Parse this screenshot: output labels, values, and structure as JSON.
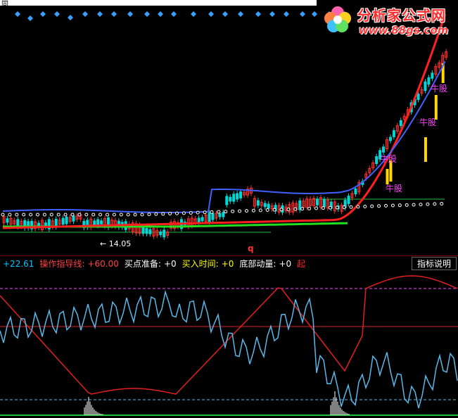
{
  "top_title": "同",
  "logo": {
    "title": "分析家公式网",
    "url": "www.88gs.com"
  },
  "chart": {
    "low_price_label": "14.05",
    "q_mark": "q",
    "signal_label": "牛股",
    "colors": {
      "up": "#ff3030",
      "down": "#00d8d8",
      "ma_red": "#ff2020",
      "ma_blue": "#4060ff",
      "ma_green": "#20e020",
      "signal_yellow": "#ffd800",
      "signal_magenta": "#ff40ff",
      "diamond": "#3aa0ff",
      "osc_blue": "#5ab8e8",
      "osc_red": "#e02020"
    }
  },
  "indicator": {
    "items": [
      {
        "label": "",
        "value": "+22.61",
        "label_color": "#00c8ff",
        "value_color": "#00c8ff"
      },
      {
        "label": "操作指导线:",
        "value": "+60.00",
        "label_color": "#ff4040",
        "value_color": "#ff4040"
      },
      {
        "label": "买点准备:",
        "value": "+0",
        "label_color": "#ffffff",
        "value_color": "#ffffff"
      },
      {
        "label": "买入时间:",
        "value": "+0",
        "label_color": "#ffff00",
        "value_color": "#ffff00"
      },
      {
        "label": "底部动量:",
        "value": "+0",
        "label_color": "#ffffff",
        "value_color": "#ffffff"
      },
      {
        "label": "起",
        "value": "",
        "label_color": "#ff2020",
        "value_color": "#ff2020"
      }
    ],
    "help_button": "指标说明"
  }
}
